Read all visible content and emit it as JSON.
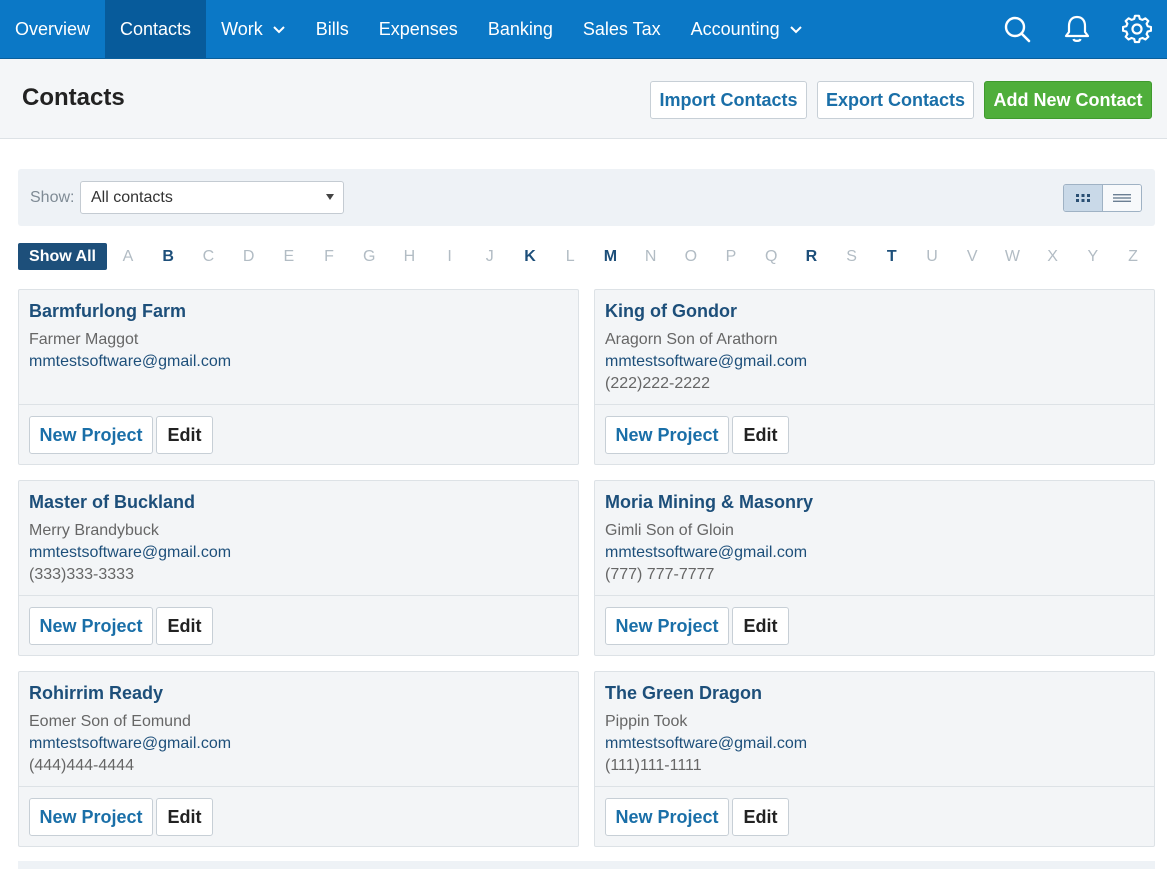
{
  "nav": {
    "items": [
      {
        "label": "Overview"
      },
      {
        "label": "Contacts",
        "active": true
      },
      {
        "label": "Work",
        "dropdown": true
      },
      {
        "label": "Bills"
      },
      {
        "label": "Expenses"
      },
      {
        "label": "Banking"
      },
      {
        "label": "Sales Tax"
      },
      {
        "label": "Accounting",
        "dropdown": true
      }
    ],
    "icons": [
      "search-icon",
      "bell-icon",
      "gear-icon"
    ]
  },
  "header": {
    "title": "Contacts",
    "import_label": "Import Contacts",
    "export_label": "Export Contacts",
    "add_label": "Add New Contact"
  },
  "filter": {
    "show_label": "Show:",
    "selected": "All contacts",
    "views": [
      "grid-view-icon",
      "list-view-icon"
    ]
  },
  "alphabet": {
    "show_all": "Show All",
    "letters": [
      "A",
      "B",
      "C",
      "D",
      "E",
      "F",
      "G",
      "H",
      "I",
      "J",
      "K",
      "L",
      "M",
      "N",
      "O",
      "P",
      "Q",
      "R",
      "S",
      "T",
      "U",
      "V",
      "W",
      "X",
      "Y",
      "Z"
    ],
    "active": [
      "B",
      "K",
      "M",
      "R",
      "T"
    ]
  },
  "contacts": [
    {
      "name": "Barmfurlong Farm",
      "person": "Farmer Maggot",
      "email": "mmtestsoftware@gmail.com",
      "phone": ""
    },
    {
      "name": "King of Gondor",
      "person": "Aragorn Son of Arathorn",
      "email": "mmtestsoftware@gmail.com",
      "phone": "(222)222-2222"
    },
    {
      "name": "Master of Buckland",
      "person": "Merry Brandybuck",
      "email": "mmtestsoftware@gmail.com",
      "phone": "(333)333-3333"
    },
    {
      "name": "Moria Mining & Masonry",
      "person": "Gimli Son of Gloin",
      "email": "mmtestsoftware@gmail.com",
      "phone": "(777) 777-7777"
    },
    {
      "name": "Rohirrim Ready",
      "person": "Eomer Son of Eomund",
      "email": "mmtestsoftware@gmail.com",
      "phone": "(444)444-4444"
    },
    {
      "name": "The Green Dragon",
      "person": "Pippin Took",
      "email": "mmtestsoftware@gmail.com",
      "phone": "(111)111-1111"
    }
  ],
  "card_actions": {
    "new_project": "New Project",
    "edit": "Edit"
  },
  "colors": {
    "nav_bg": "#0b78c6",
    "nav_active": "#075b9b",
    "primary_text": "#1d4f7a",
    "link": "#1a6fa8",
    "green": "#4fae3b"
  }
}
